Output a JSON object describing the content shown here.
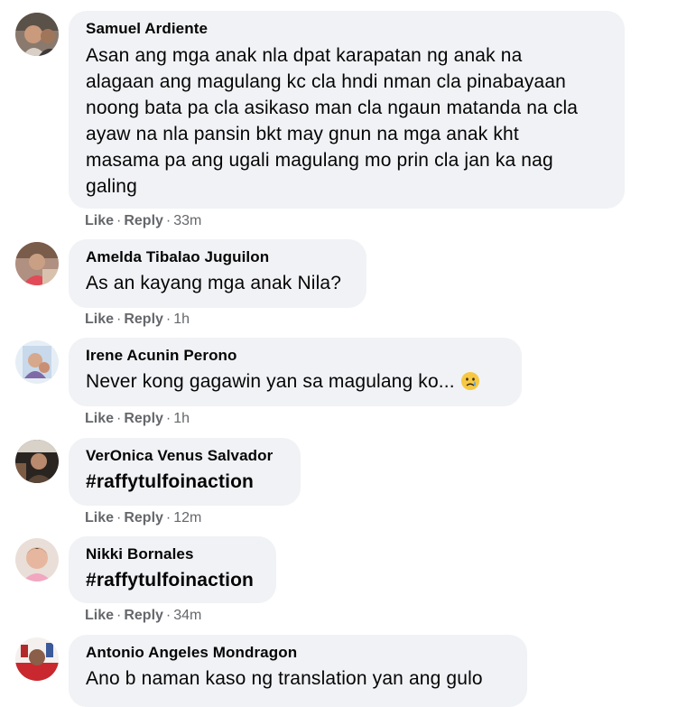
{
  "actions": {
    "like": "Like",
    "reply": "Reply",
    "separator": "·"
  },
  "comments": [
    {
      "author": "Samuel Ardiente",
      "lines": [
        "Asan ang mga anak nla dpat karapatan ng anak na",
        "alagaan ang magulang kc cla hndi nman cla pinabayaan",
        "noong bata pa cla asikaso man cla ngaun matanda na cla",
        "ayaw na nla pansin bkt may gnun na mga anak kht",
        "masama pa ang ugali magulang mo prin cla jan ka nag",
        "galing"
      ],
      "time": "33m"
    },
    {
      "author": "Amelda Tibalao Juguilon",
      "text": "As an kayang mga anak Nila?",
      "time": "1h"
    },
    {
      "author": "Irene Acunin Perono",
      "text": "Never kong gagawin yan sa magulang ko...",
      "emoji": "crying-face-emoji",
      "time": "1h"
    },
    {
      "author": "VerOnica Venus Salvador",
      "text": "#raffytulfoinaction",
      "time": "12m"
    },
    {
      "author": "Nikki Bornales",
      "text": "#raffytulfoinaction",
      "time": "34m"
    },
    {
      "author": "Antonio Angeles Mondragon",
      "text": "Ano b naman kaso ng translation yan ang gulo"
    }
  ],
  "colors": {
    "bubble": "#f0f2f5",
    "meta": "#65676b",
    "text": "#050505"
  }
}
